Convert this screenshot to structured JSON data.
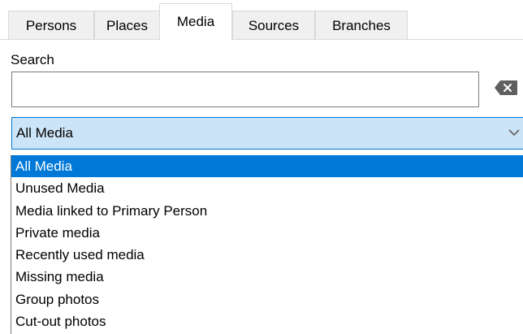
{
  "tabs": [
    {
      "label": "Persons"
    },
    {
      "label": "Places"
    },
    {
      "label": "Media",
      "active": true
    },
    {
      "label": "Sources"
    },
    {
      "label": "Branches"
    }
  ],
  "search": {
    "label": "Search",
    "value": "",
    "clear_icon": "backspace-clear-icon"
  },
  "filter": {
    "selected": "All Media",
    "expanded": true,
    "chevron_icon": "chevron-down-icon",
    "options": [
      "All Media",
      "Unused Media",
      "Media linked to Primary Person",
      "Private media",
      "Recently used media",
      "Missing media",
      "Group photos",
      "Cut-out photos"
    ]
  },
  "colors": {
    "selection": "#0078d7",
    "combo_fill": "#cce4f7",
    "tab_inactive": "#f0f0f0"
  }
}
